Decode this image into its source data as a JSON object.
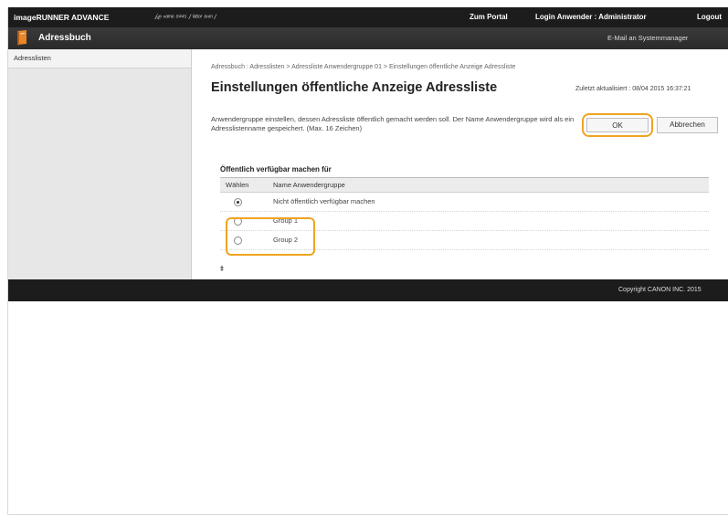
{
  "topbar": {
    "brand": "imageRUNNER ADVANCE",
    "device": "ⅈⅇ ⁿᵃᵐᵉ ⁸²⁴⁵ / ˡᵃᵇᵒʳ ᵃⁿᵐ /",
    "portal_link": "Zum Portal",
    "login_label": "Login Anwender : Administrator",
    "logout_link": "Logout"
  },
  "subbar": {
    "title": "Adressbuch",
    "mail_link": "E-Mail an Systemmanager"
  },
  "sidebar": {
    "items": [
      {
        "label": "Adresslisten"
      }
    ]
  },
  "main": {
    "breadcrumb": "Adressbuch : Adresslisten > Adressliste Anwendergruppe 01 > Einstellungen öffentliche Anzeige Adressliste",
    "title": "Einstellungen öffentliche Anzeige Adressliste",
    "updated": "Zuletzt aktualisiert : 08/04 2015 16:37:21",
    "description": "Anwendergruppe einstellen, dessen Adressliste öffentlich gemacht werden soll. Der Name Anwendergruppe wird als ein Adresslistenname gespeichert. (Max. 16 Zeichen)",
    "ok_label": "OK",
    "cancel_label": "Abbrechen",
    "section_title": "Öffentlich verfügbar machen für",
    "table": {
      "headers": [
        "Wählen",
        "Name Anwendergruppe"
      ],
      "rows": [
        {
          "name": "Nicht öffentlich verfügbar machen",
          "selected": true
        },
        {
          "name": "Group 1",
          "selected": false
        },
        {
          "name": "Group 2",
          "selected": false
        }
      ]
    },
    "to_top": "⯒"
  },
  "footer": {
    "copyright": "Copyright CANON INC. 2015"
  },
  "colors": {
    "highlight": "#f0a321",
    "topbar": "#1c1c1c",
    "book_icon": "#e8862a"
  }
}
